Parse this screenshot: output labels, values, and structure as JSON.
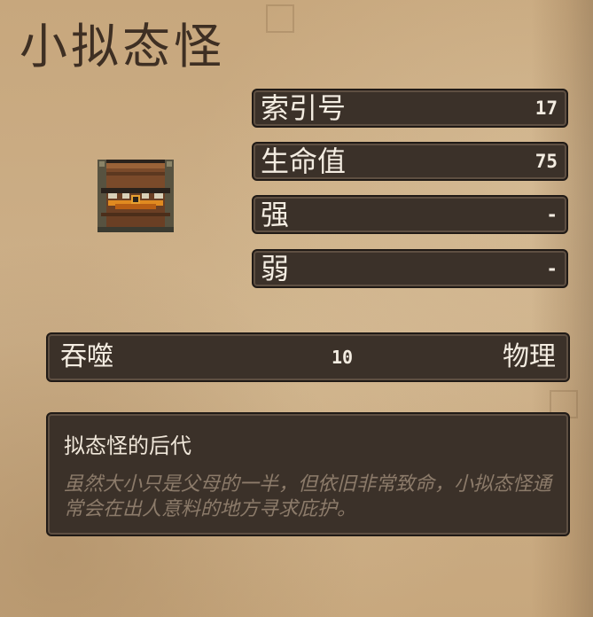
{
  "monster": {
    "name": "小拟态怪"
  },
  "stats": [
    {
      "label": "索引号",
      "value": "17"
    },
    {
      "label": "生命值",
      "value": "75"
    },
    {
      "label": "强",
      "value": "-"
    },
    {
      "label": "弱",
      "value": "-"
    }
  ],
  "attack": {
    "name": "吞噬",
    "value": "10",
    "type": "物理"
  },
  "description": {
    "title": "拟态怪的后代",
    "text": "虽然大小只是父母的一半，但依旧非常致命，小拟态怪通常会在出人意料的地方寻求庇护。"
  },
  "colors": {
    "panel_bg": "#3b3129",
    "panel_border": "#201a16",
    "parchment": "#c9ab82",
    "title_text": "#3e2f23",
    "desc_text": "#8c7b6a"
  },
  "icons": {
    "portrait": "mimic-chest-icon"
  }
}
